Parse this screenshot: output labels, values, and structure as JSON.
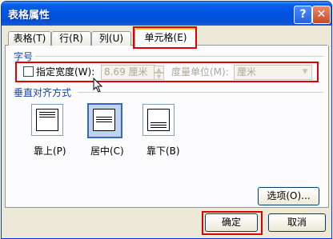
{
  "window": {
    "title": "表格属性",
    "help_label": "?",
    "close_label": "✕"
  },
  "tabs": [
    {
      "label": "表格(T)",
      "active": false
    },
    {
      "label": "行(R)",
      "active": false
    },
    {
      "label": "列(U)",
      "active": false
    },
    {
      "label": "单元格(E)",
      "active": true
    }
  ],
  "size_section": {
    "title": "字号",
    "specify_width_label": "指定宽度(W):",
    "specify_width_checked": false,
    "width_value": "8.69 厘米",
    "measure_label": "度量单位(M):",
    "measure_value": "厘米"
  },
  "valign_section": {
    "title": "垂直对齐方式",
    "options": [
      {
        "label": "靠上(P)",
        "selected": false
      },
      {
        "label": "居中(C)",
        "selected": true
      },
      {
        "label": "靠下(B)",
        "selected": false
      }
    ]
  },
  "buttons": {
    "options": "选项(O)...",
    "ok": "确定",
    "cancel": "取消"
  },
  "icons": {
    "cursor": "mouse-pointer-icon",
    "help": "help-icon",
    "close": "close-icon",
    "spin_up": "up-arrow-icon",
    "spin_down": "down-arrow-icon",
    "dropdown": "chevron-down-icon"
  },
  "colors": {
    "title_bar": "#0054e3",
    "section_title": "#1542a8",
    "highlight_box": "#e00000",
    "selected_option": "#316ac5"
  }
}
